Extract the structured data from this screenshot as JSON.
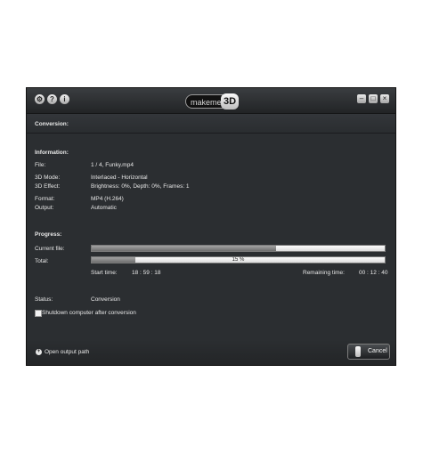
{
  "titlebar": {
    "icons": [
      "settings-icon",
      "help-icon",
      "info-icon"
    ],
    "logo_text": "makeme",
    "logo_badge": "3D",
    "buttons": [
      "minimize",
      "maximize",
      "close"
    ]
  },
  "section_title": "Conversion:",
  "information": {
    "heading": "Information:",
    "rows": [
      {
        "label": "File:",
        "value": "1 / 4, Funky.mp4"
      },
      {
        "label": "3D Mode:",
        "value": "Interlaced - Horizontal"
      },
      {
        "label": "3D Effect:",
        "value": "Brightness: 0%, Depth: 0%, Frames: 1"
      },
      {
        "label": "Format:",
        "value": "MP4 (H.264)"
      },
      {
        "label": "Output:",
        "value": "Automatic"
      }
    ]
  },
  "progress": {
    "heading": "Progress:",
    "current_file_label": "Current file:",
    "current_file_fraction": 0.63,
    "total_label": "Total:",
    "total_fraction": 0.15,
    "total_percent_text": "15 %",
    "start_time_label": "Start time:",
    "start_time_value": "18 : 59 : 18",
    "remaining_label": "Remaining time:",
    "remaining_value": "00 : 12 : 40"
  },
  "status": {
    "label": "Status:",
    "value": "Conversion"
  },
  "shutdown_label": "Shutdown computer after conversion",
  "shutdown_checked": false,
  "footer": {
    "open_output_label": "Open output path",
    "cancel_label": "Cancel"
  }
}
